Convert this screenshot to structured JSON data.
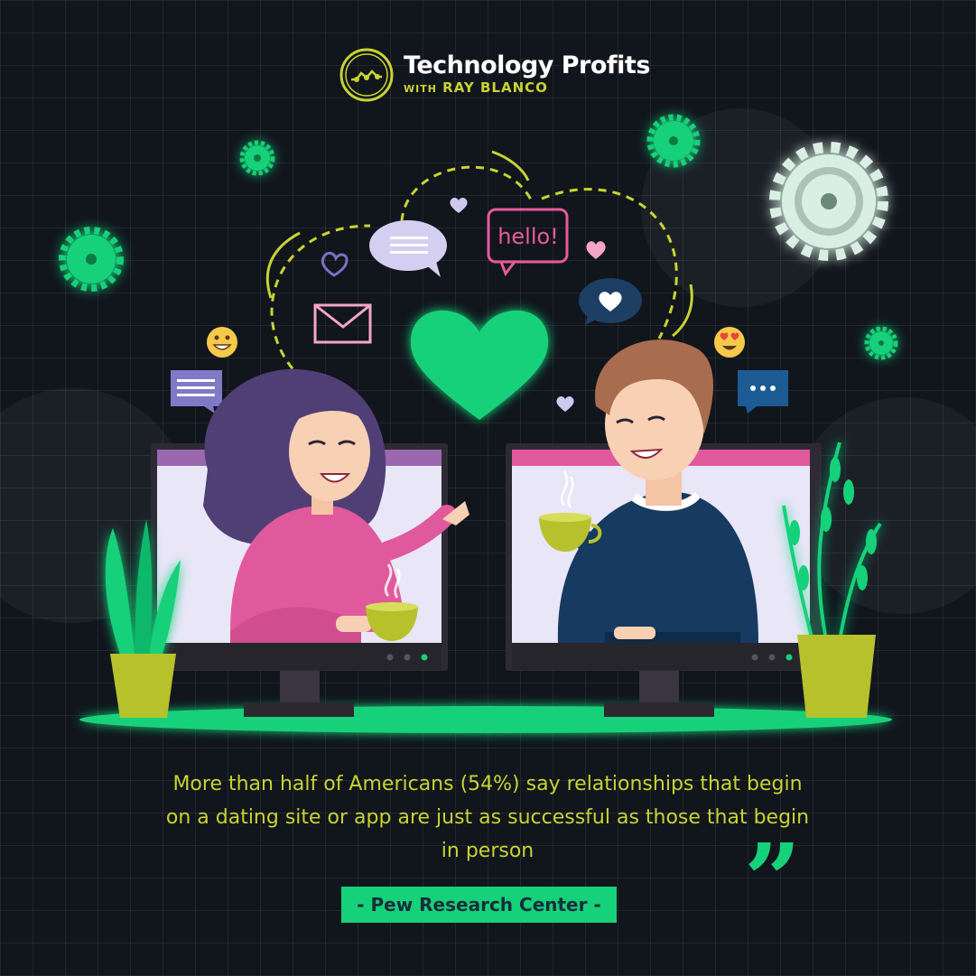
{
  "brand": {
    "title": "Technology Profits",
    "subtitle_prefix": "WITH",
    "subtitle_name": "RAY BLANCO",
    "colors": {
      "accent_green": "#14d17a",
      "accent_yellow": "#c9d332",
      "background": "#11151c",
      "pink": "#e85a9c"
    }
  },
  "illustration": {
    "speech_bubble_text": "hello!",
    "icons": [
      "heart-icon",
      "envelope-icon",
      "chat-bubble-icon",
      "gear-icon",
      "smiley-icon",
      "heart-eyes-icon",
      "ellipsis-bubble-icon"
    ]
  },
  "quote": {
    "text": "More than half of Americans (54%) say relationships that begin on a dating site or app are just as successful as those that begin in person",
    "mark": "”",
    "source": "- Pew Research Center -"
  }
}
